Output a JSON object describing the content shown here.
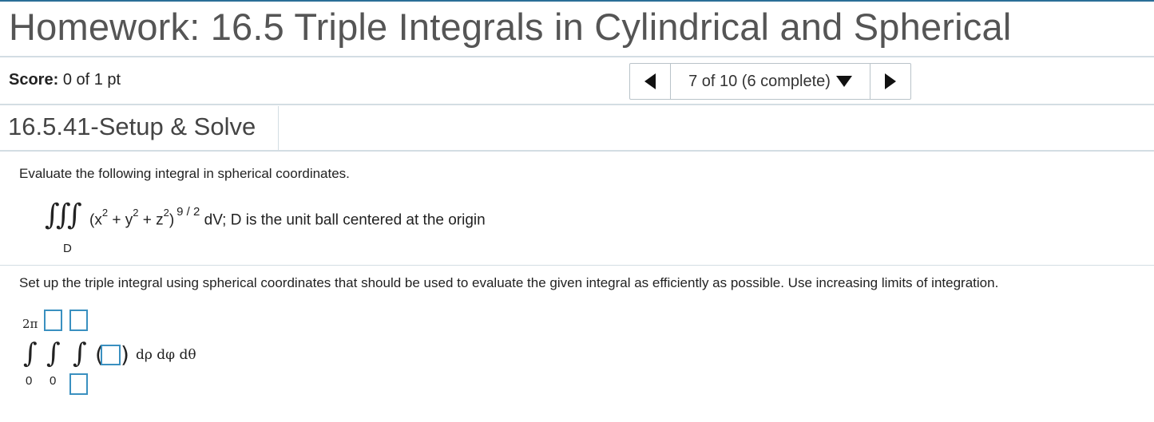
{
  "header": {
    "title": "Homework: 16.5 Triple Integrals in Cylindrical and Spherical"
  },
  "score": {
    "label": "Score:",
    "value": "0 of 1 pt"
  },
  "navigation": {
    "progress": "7 of 10 (6 complete)"
  },
  "problem": {
    "id": "16.5.41-Setup & Solve",
    "instruction": "Evaluate the following integral in spherical coordinates.",
    "integral_expression": {
      "base": "(x",
      "parts": [
        "(x",
        "2",
        " + y",
        "2",
        " + z",
        "2",
        ")"
      ],
      "exponent": "9 / 2",
      "tail": "dV; D is the unit ball centered at the origin",
      "region": "D"
    },
    "setup_instruction": "Set up the triple integral using spherical coordinates that should be used to evaluate the given integral as efficiently as possible. Use increasing limits of integration.",
    "setup": {
      "outer_upper": "2π",
      "outer_lower": "0",
      "middle_lower": "0",
      "differentials": "dρ dφ dθ"
    }
  }
}
